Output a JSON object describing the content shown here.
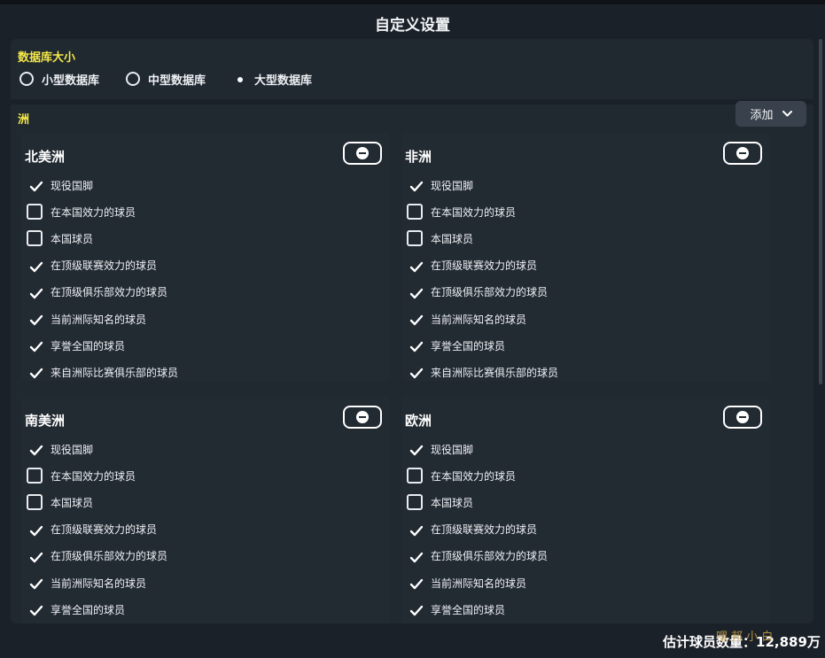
{
  "title": "自定义设置",
  "database_size": {
    "label": "数据库大小",
    "options": [
      {
        "label": "小型数据库",
        "selected": false
      },
      {
        "label": "中型数据库",
        "selected": false
      },
      {
        "label": "大型数据库",
        "selected": true
      }
    ]
  },
  "continent_section": {
    "label": "洲",
    "add_button_label": "添加",
    "add_button_icon": "chevron-down-icon"
  },
  "continents": [
    {
      "name": "北美洲",
      "remove_icon": "minus-circle-icon",
      "options": [
        {
          "label": "现役国脚",
          "checked": true
        },
        {
          "label": "在本国效力的球员",
          "checked": false
        },
        {
          "label": "本国球员",
          "checked": false
        },
        {
          "label": "在顶级联赛效力的球员",
          "checked": true
        },
        {
          "label": "在顶级俱乐部效力的球员",
          "checked": true
        },
        {
          "label": "当前洲际知名的球员",
          "checked": true
        },
        {
          "label": "享誉全国的球员",
          "checked": true
        },
        {
          "label": "来自洲际比赛俱乐部的球员",
          "checked": true
        }
      ]
    },
    {
      "name": "非洲",
      "remove_icon": "minus-circle-icon",
      "options": [
        {
          "label": "现役国脚",
          "checked": true
        },
        {
          "label": "在本国效力的球员",
          "checked": false
        },
        {
          "label": "本国球员",
          "checked": false
        },
        {
          "label": "在顶级联赛效力的球员",
          "checked": true
        },
        {
          "label": "在顶级俱乐部效力的球员",
          "checked": true
        },
        {
          "label": "当前洲际知名的球员",
          "checked": true
        },
        {
          "label": "享誉全国的球员",
          "checked": true
        },
        {
          "label": "来自洲际比赛俱乐部的球员",
          "checked": true
        }
      ]
    },
    {
      "name": "南美洲",
      "remove_icon": "minus-circle-icon",
      "options": [
        {
          "label": "现役国脚",
          "checked": true
        },
        {
          "label": "在本国效力的球员",
          "checked": false
        },
        {
          "label": "本国球员",
          "checked": false
        },
        {
          "label": "在顶级联赛效力的球员",
          "checked": true
        },
        {
          "label": "在顶级俱乐部效力的球员",
          "checked": true
        },
        {
          "label": "当前洲际知名的球员",
          "checked": true
        },
        {
          "label": "享誉全国的球员",
          "checked": true
        }
      ]
    },
    {
      "name": "欧洲",
      "remove_icon": "minus-circle-icon",
      "options": [
        {
          "label": "现役国脚",
          "checked": true
        },
        {
          "label": "在本国效力的球员",
          "checked": false
        },
        {
          "label": "本国球员",
          "checked": false
        },
        {
          "label": "在顶级联赛效力的球员",
          "checked": true
        },
        {
          "label": "在顶级俱乐部效力的球员",
          "checked": true
        },
        {
          "label": "当前洲际知名的球员",
          "checked": true
        },
        {
          "label": "享誉全国的球员",
          "checked": true
        }
      ]
    }
  ],
  "footer": {
    "estimate_text": "估计球员数量：12,889万"
  },
  "watermark_text": "嘿 邦 小 白",
  "colors": {
    "background": "#1b2129",
    "panel": "#202830",
    "section_label": "#f5e84a",
    "button": "#39424c"
  }
}
